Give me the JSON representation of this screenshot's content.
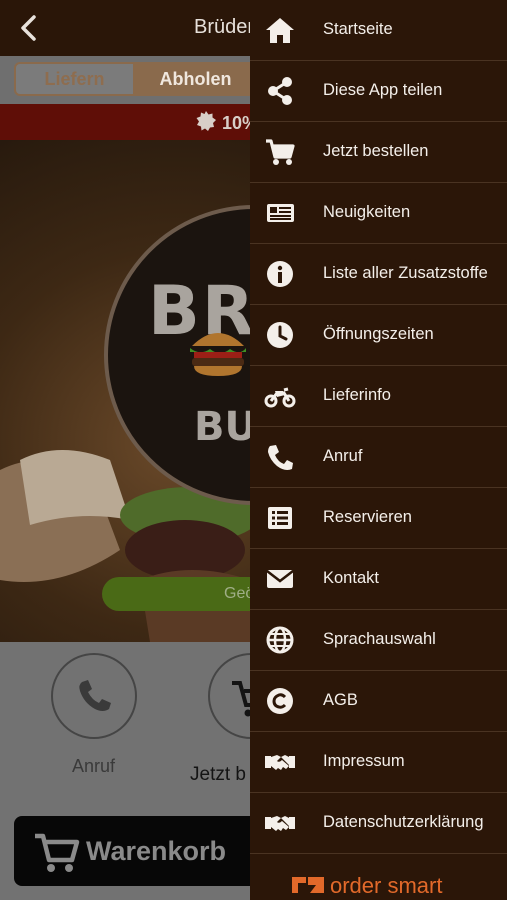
{
  "app": {
    "title": "Brüder",
    "tabs": {
      "deliver": "Liefern",
      "pickup": "Abholen",
      "selected": "Abholen"
    },
    "promo": "10%",
    "logo": {
      "line1": "BRÜ",
      "line2": "BUR"
    },
    "status_pill": "Geö",
    "actions": {
      "call": "Anruf",
      "order": "Jetzt b"
    },
    "cart": "Warenkorb"
  },
  "drawer": {
    "items": [
      {
        "label": "Startseite",
        "icon": "home-icon"
      },
      {
        "label": "Diese App teilen",
        "icon": "share-icon"
      },
      {
        "label": "Jetzt bestellen",
        "icon": "cart-icon"
      },
      {
        "label": "Neuigkeiten",
        "icon": "news-icon"
      },
      {
        "label": "Liste aller Zusatzstoffe",
        "icon": "info-icon"
      },
      {
        "label": "Öffnungszeiten",
        "icon": "clock-icon"
      },
      {
        "label": "Lieferinfo",
        "icon": "motorcycle-icon"
      },
      {
        "label": "Anruf",
        "icon": "phone-icon"
      },
      {
        "label": "Reservieren",
        "icon": "list-icon"
      },
      {
        "label": "Kontakt",
        "icon": "envelope-icon"
      },
      {
        "label": "Sprachauswahl",
        "icon": "globe-icon"
      },
      {
        "label": "AGB",
        "icon": "copyright-icon"
      },
      {
        "label": "Impressum",
        "icon": "handshake-icon"
      },
      {
        "label": "Datenschutzerklärung",
        "icon": "handshake-icon"
      }
    ],
    "brand": "order smart"
  },
  "colors": {
    "drawer_bg": "#2b1608",
    "accent_brown": "#8a6a4c",
    "promo_red": "#5f0e07",
    "brand_orange": "#e2692a",
    "pill_green": "#4a6a16"
  }
}
